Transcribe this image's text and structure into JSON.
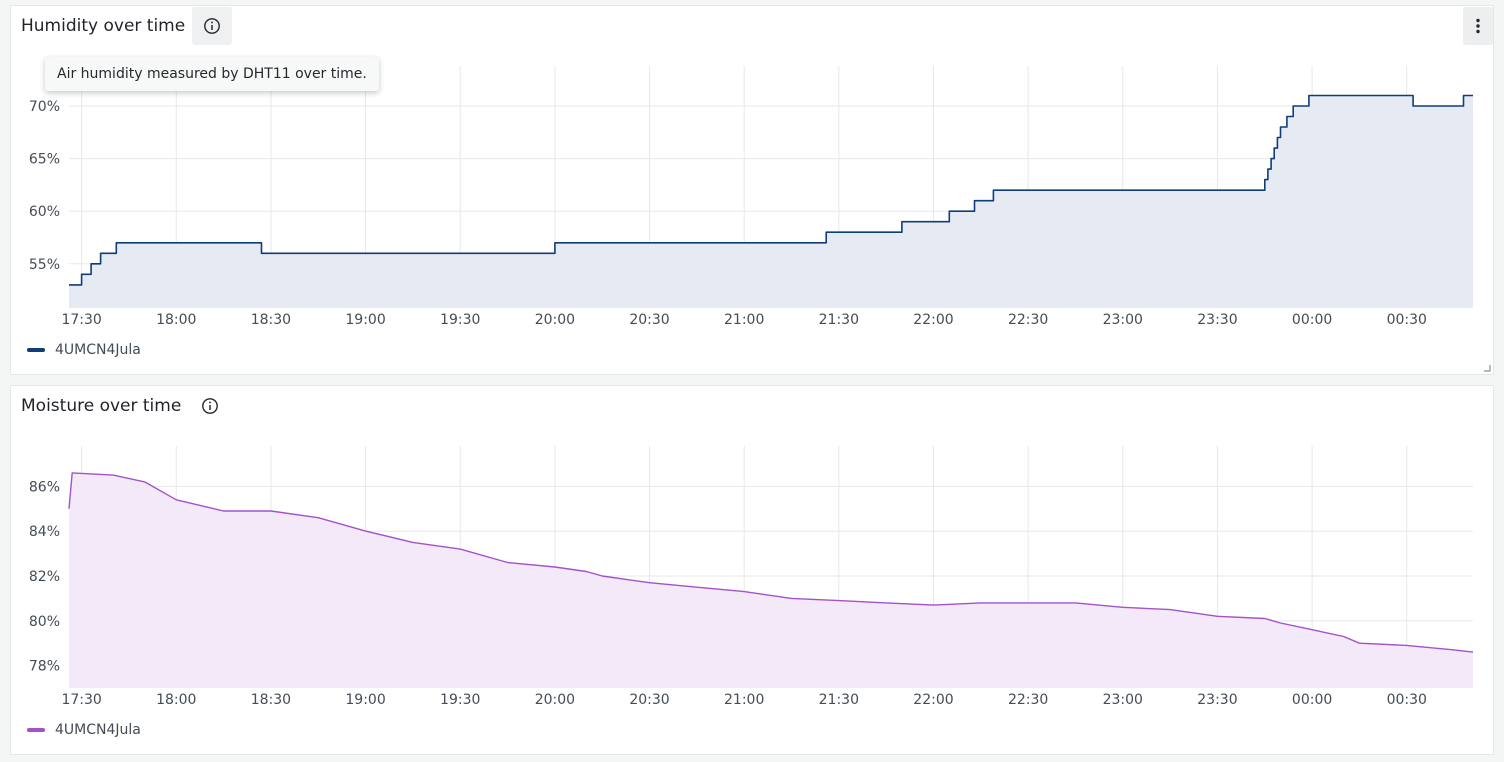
{
  "panels": [
    {
      "title": "Humidity over time",
      "tooltip": "Air humidity measured by DHT11 over time.",
      "legend_label": "4UMCN4Jula",
      "series_color": "#0e3d7a",
      "fill_color": "#e6eaf2",
      "icons": [
        "info-icon",
        "more-vertical-icon",
        "resize-handle-icon"
      ]
    },
    {
      "title": "Moisture over time",
      "legend_label": "4UMCN4Jula",
      "series_color": "#a352cc",
      "fill_color": "#f3e9f8",
      "icons": [
        "info-icon"
      ]
    }
  ],
  "chart_data": [
    {
      "type": "area",
      "title": "Humidity over time",
      "x_ticks": [
        "17:30",
        "18:00",
        "18:30",
        "19:00",
        "19:30",
        "20:00",
        "20:30",
        "21:00",
        "21:30",
        "22:00",
        "22:30",
        "23:00",
        "23:30",
        "00:00",
        "00:30"
      ],
      "y_ticks": [
        "55%",
        "60%",
        "65%",
        "70%"
      ],
      "ylim": [
        50.8,
        73.8
      ],
      "xlim": [
        "17:26",
        "00:51"
      ],
      "grid": true,
      "legend": "bottom-left",
      "series": [
        {
          "name": "4UMCN4Jula",
          "points": [
            [
              "17:26",
              53
            ],
            [
              "17:30",
              54
            ],
            [
              "17:33",
              55
            ],
            [
              "17:36",
              56
            ],
            [
              "17:41",
              57
            ],
            [
              "18:00",
              57
            ],
            [
              "18:15",
              57
            ],
            [
              "18:27",
              56
            ],
            [
              "19:00",
              56
            ],
            [
              "19:30",
              56
            ],
            [
              "20:00",
              57
            ],
            [
              "20:30",
              57
            ],
            [
              "21:00",
              57
            ],
            [
              "21:24",
              57
            ],
            [
              "21:26",
              58
            ],
            [
              "21:50",
              59
            ],
            [
              "22:05",
              60
            ],
            [
              "22:13",
              61
            ],
            [
              "22:19",
              62
            ],
            [
              "22:30",
              62
            ],
            [
              "23:00",
              62
            ],
            [
              "23:30",
              62
            ],
            [
              "23:44",
              62
            ],
            [
              "23:45",
              63
            ],
            [
              "23:46",
              64
            ],
            [
              "23:47",
              65
            ],
            [
              "23:48",
              66
            ],
            [
              "23:49",
              67
            ],
            [
              "23:50",
              68
            ],
            [
              "23:52",
              69
            ],
            [
              "23:54",
              70
            ],
            [
              "23:59",
              71
            ],
            [
              "00:30",
              71
            ],
            [
              "00:32",
              70
            ],
            [
              "00:47",
              70
            ],
            [
              "00:48",
              71
            ],
            [
              "00:51",
              71
            ]
          ]
        }
      ]
    },
    {
      "type": "area",
      "title": "Moisture over time",
      "x_ticks": [
        "17:30",
        "18:00",
        "18:30",
        "19:00",
        "19:30",
        "20:00",
        "20:30",
        "21:00",
        "21:30",
        "22:00",
        "22:30",
        "23:00",
        "23:30",
        "00:00",
        "00:30"
      ],
      "y_ticks": [
        "78%",
        "80%",
        "82%",
        "84%",
        "86%"
      ],
      "ylim": [
        77.0,
        87.8
      ],
      "xlim": [
        "17:26",
        "00:51"
      ],
      "grid": true,
      "legend": "bottom-left",
      "series": [
        {
          "name": "4UMCN4Jula",
          "points": [
            [
              "17:26",
              85.0
            ],
            [
              "17:27",
              86.6
            ],
            [
              "17:40",
              86.5
            ],
            [
              "17:50",
              86.2
            ],
            [
              "18:00",
              85.4
            ],
            [
              "18:15",
              84.9
            ],
            [
              "18:30",
              84.9
            ],
            [
              "18:45",
              84.6
            ],
            [
              "19:00",
              84.0
            ],
            [
              "19:15",
              83.5
            ],
            [
              "19:30",
              83.2
            ],
            [
              "19:45",
              82.6
            ],
            [
              "20:00",
              82.4
            ],
            [
              "20:10",
              82.2
            ],
            [
              "20:15",
              82.0
            ],
            [
              "20:30",
              81.7
            ],
            [
              "20:45",
              81.5
            ],
            [
              "21:00",
              81.3
            ],
            [
              "21:15",
              81.0
            ],
            [
              "21:30",
              80.9
            ],
            [
              "21:45",
              80.8
            ],
            [
              "22:00",
              80.7
            ],
            [
              "22:15",
              80.8
            ],
            [
              "22:30",
              80.8
            ],
            [
              "22:45",
              80.8
            ],
            [
              "23:00",
              80.6
            ],
            [
              "23:15",
              80.5
            ],
            [
              "23:30",
              80.2
            ],
            [
              "23:45",
              80.1
            ],
            [
              "23:50",
              79.9
            ],
            [
              "00:00",
              79.6
            ],
            [
              "00:10",
              79.3
            ],
            [
              "00:15",
              79.0
            ],
            [
              "00:30",
              78.9
            ],
            [
              "00:45",
              78.7
            ],
            [
              "00:51",
              78.6
            ]
          ]
        }
      ]
    }
  ]
}
